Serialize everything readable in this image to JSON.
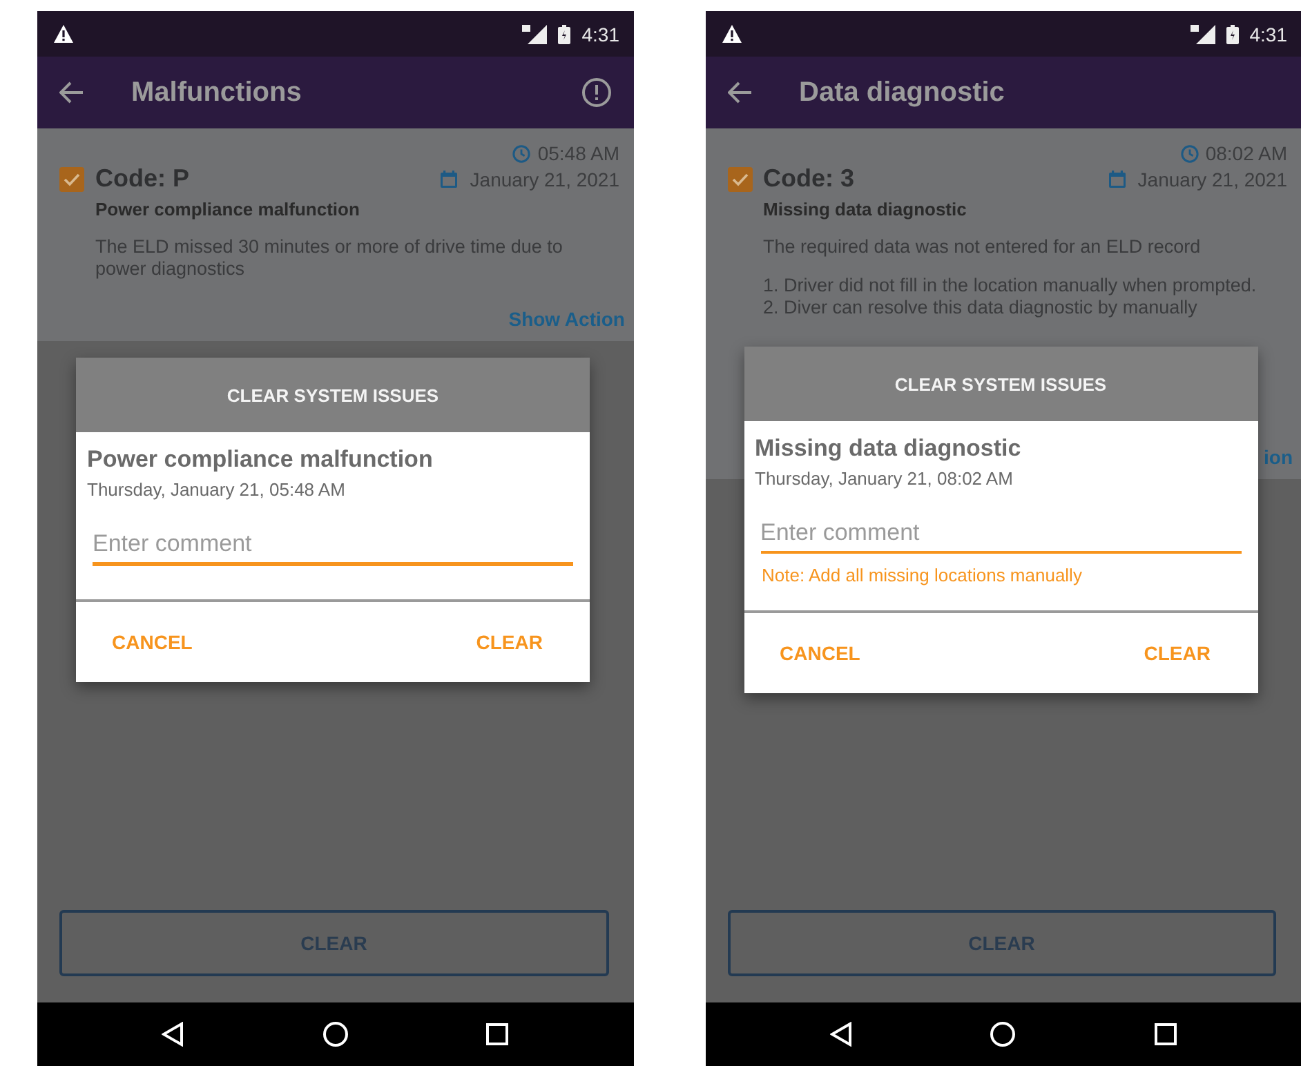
{
  "screens": [
    {
      "status_bar": {
        "time": "4:31"
      },
      "app_bar": {
        "title": "Malfunctions",
        "info_button": true
      },
      "issue": {
        "checked": true,
        "time": "05:48 AM",
        "code": "Code: P",
        "date": "January 21, 2021",
        "name": "Power compliance malfunction",
        "paragraphs": [
          [
            "The ELD missed 30 minutes or more of drive time due to power diagnostics"
          ]
        ],
        "action": "Show Action"
      },
      "dialog": {
        "title": "CLEAR SYSTEM ISSUES",
        "issue_name": "Power compliance malfunction",
        "timestamp": "Thursday, January 21, 05:48 AM",
        "comment": {
          "placeholder": "Enter comment"
        },
        "buttons": [
          "CANCEL",
          "CLEAR"
        ]
      },
      "bottom_button": "CLEAR"
    },
    {
      "status_bar": {
        "time": "4:31"
      },
      "app_bar": {
        "title": "Data diagnostic",
        "info_button": false
      },
      "issue": {
        "checked": true,
        "time": "08:02 AM",
        "code": "Code: 3",
        "date": "January 21, 2021",
        "name": "Missing data diagnostic",
        "paragraphs": [
          [
            "The required data was not entered for an ELD record"
          ],
          [
            "1. Driver did not fill in the location manually when prompted.",
            "2. Diver can resolve this data diagnostic by manually"
          ]
        ],
        "action": "ion"
      },
      "dialog": {
        "title": "CLEAR SYSTEM ISSUES",
        "issue_name": "Missing data diagnostic",
        "timestamp": "Thursday, January 21, 08:02 AM",
        "comment": {
          "placeholder": "Enter comment"
        },
        "note": "Note: Add all missing locations manually",
        "buttons": [
          "CANCEL",
          "CLEAR"
        ]
      },
      "bottom_button": "CLEAR"
    }
  ]
}
